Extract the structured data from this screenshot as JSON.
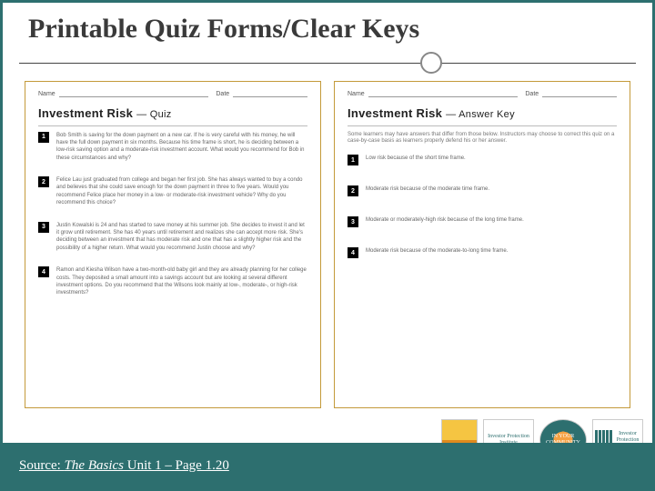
{
  "title": "Printable Quiz Forms/Clear Keys",
  "quiz": {
    "name_label": "Name",
    "date_label": "Date",
    "heading": "Investment Risk",
    "heading_sub": "— Quiz",
    "items": [
      {
        "n": "1",
        "t": "Bob Smith is saving for the down payment on a new car. If he is very careful with his money, he will have the full down payment in six months. Because his time frame is short, he is deciding between a low-risk saving option and a moderate-risk investment account. What would you recommend for Bob in these circumstances and why?"
      },
      {
        "n": "2",
        "t": "Felice Lau just graduated from college and began her first job. She has always wanted to buy a condo and believes that she could save enough for the down payment in three to five years. Would you recommend Felice place her money in a low- or moderate-risk investment vehicle? Why do you recommend this choice?"
      },
      {
        "n": "3",
        "t": "Justin Kowalski is 24 and has started to save money at his summer job. She decides to invest it and let it grow until retirement. She has 40 years until retirement and realizes she can accept more risk. She's deciding between an investment that has moderate risk and one that has a slightly higher risk and the possibility of a higher return. What would you recommend Justin choose and why?"
      },
      {
        "n": "4",
        "t": "Ramon and Kiesha Wilson have a two-month-old baby girl and they are already planning for her college costs. They deposited a small amount into a savings account but are looking at several different investment options. Do you recommend that the Wilsons look mainly at low-, moderate-, or high-risk investments?"
      }
    ]
  },
  "key": {
    "name_label": "Name",
    "date_label": "Date",
    "heading": "Investment Risk",
    "heading_sub": "— Answer Key",
    "note": "Some learners may have answers that differ from those below. Instructors may choose to correct this quiz on a case-by-case basis as learners properly defend his or her answer.",
    "items": [
      {
        "n": "1",
        "t": "Low risk because of the short time frame."
      },
      {
        "n": "2",
        "t": "Moderate risk because of the moderate time frame."
      },
      {
        "n": "3",
        "t": "Moderate or moderately-high risk because of the long time frame."
      },
      {
        "n": "4",
        "t": "Moderate risk because of the moderate-to-long time frame."
      }
    ]
  },
  "source": {
    "pre": "Source: ",
    "title": "The Basics",
    "post": " Unit 1 – Page 1.20"
  },
  "logos": {
    "b": "Investor Protection Institute",
    "c": "IN YOUR COMMUNITY",
    "d": "Investor Protection Trust"
  }
}
